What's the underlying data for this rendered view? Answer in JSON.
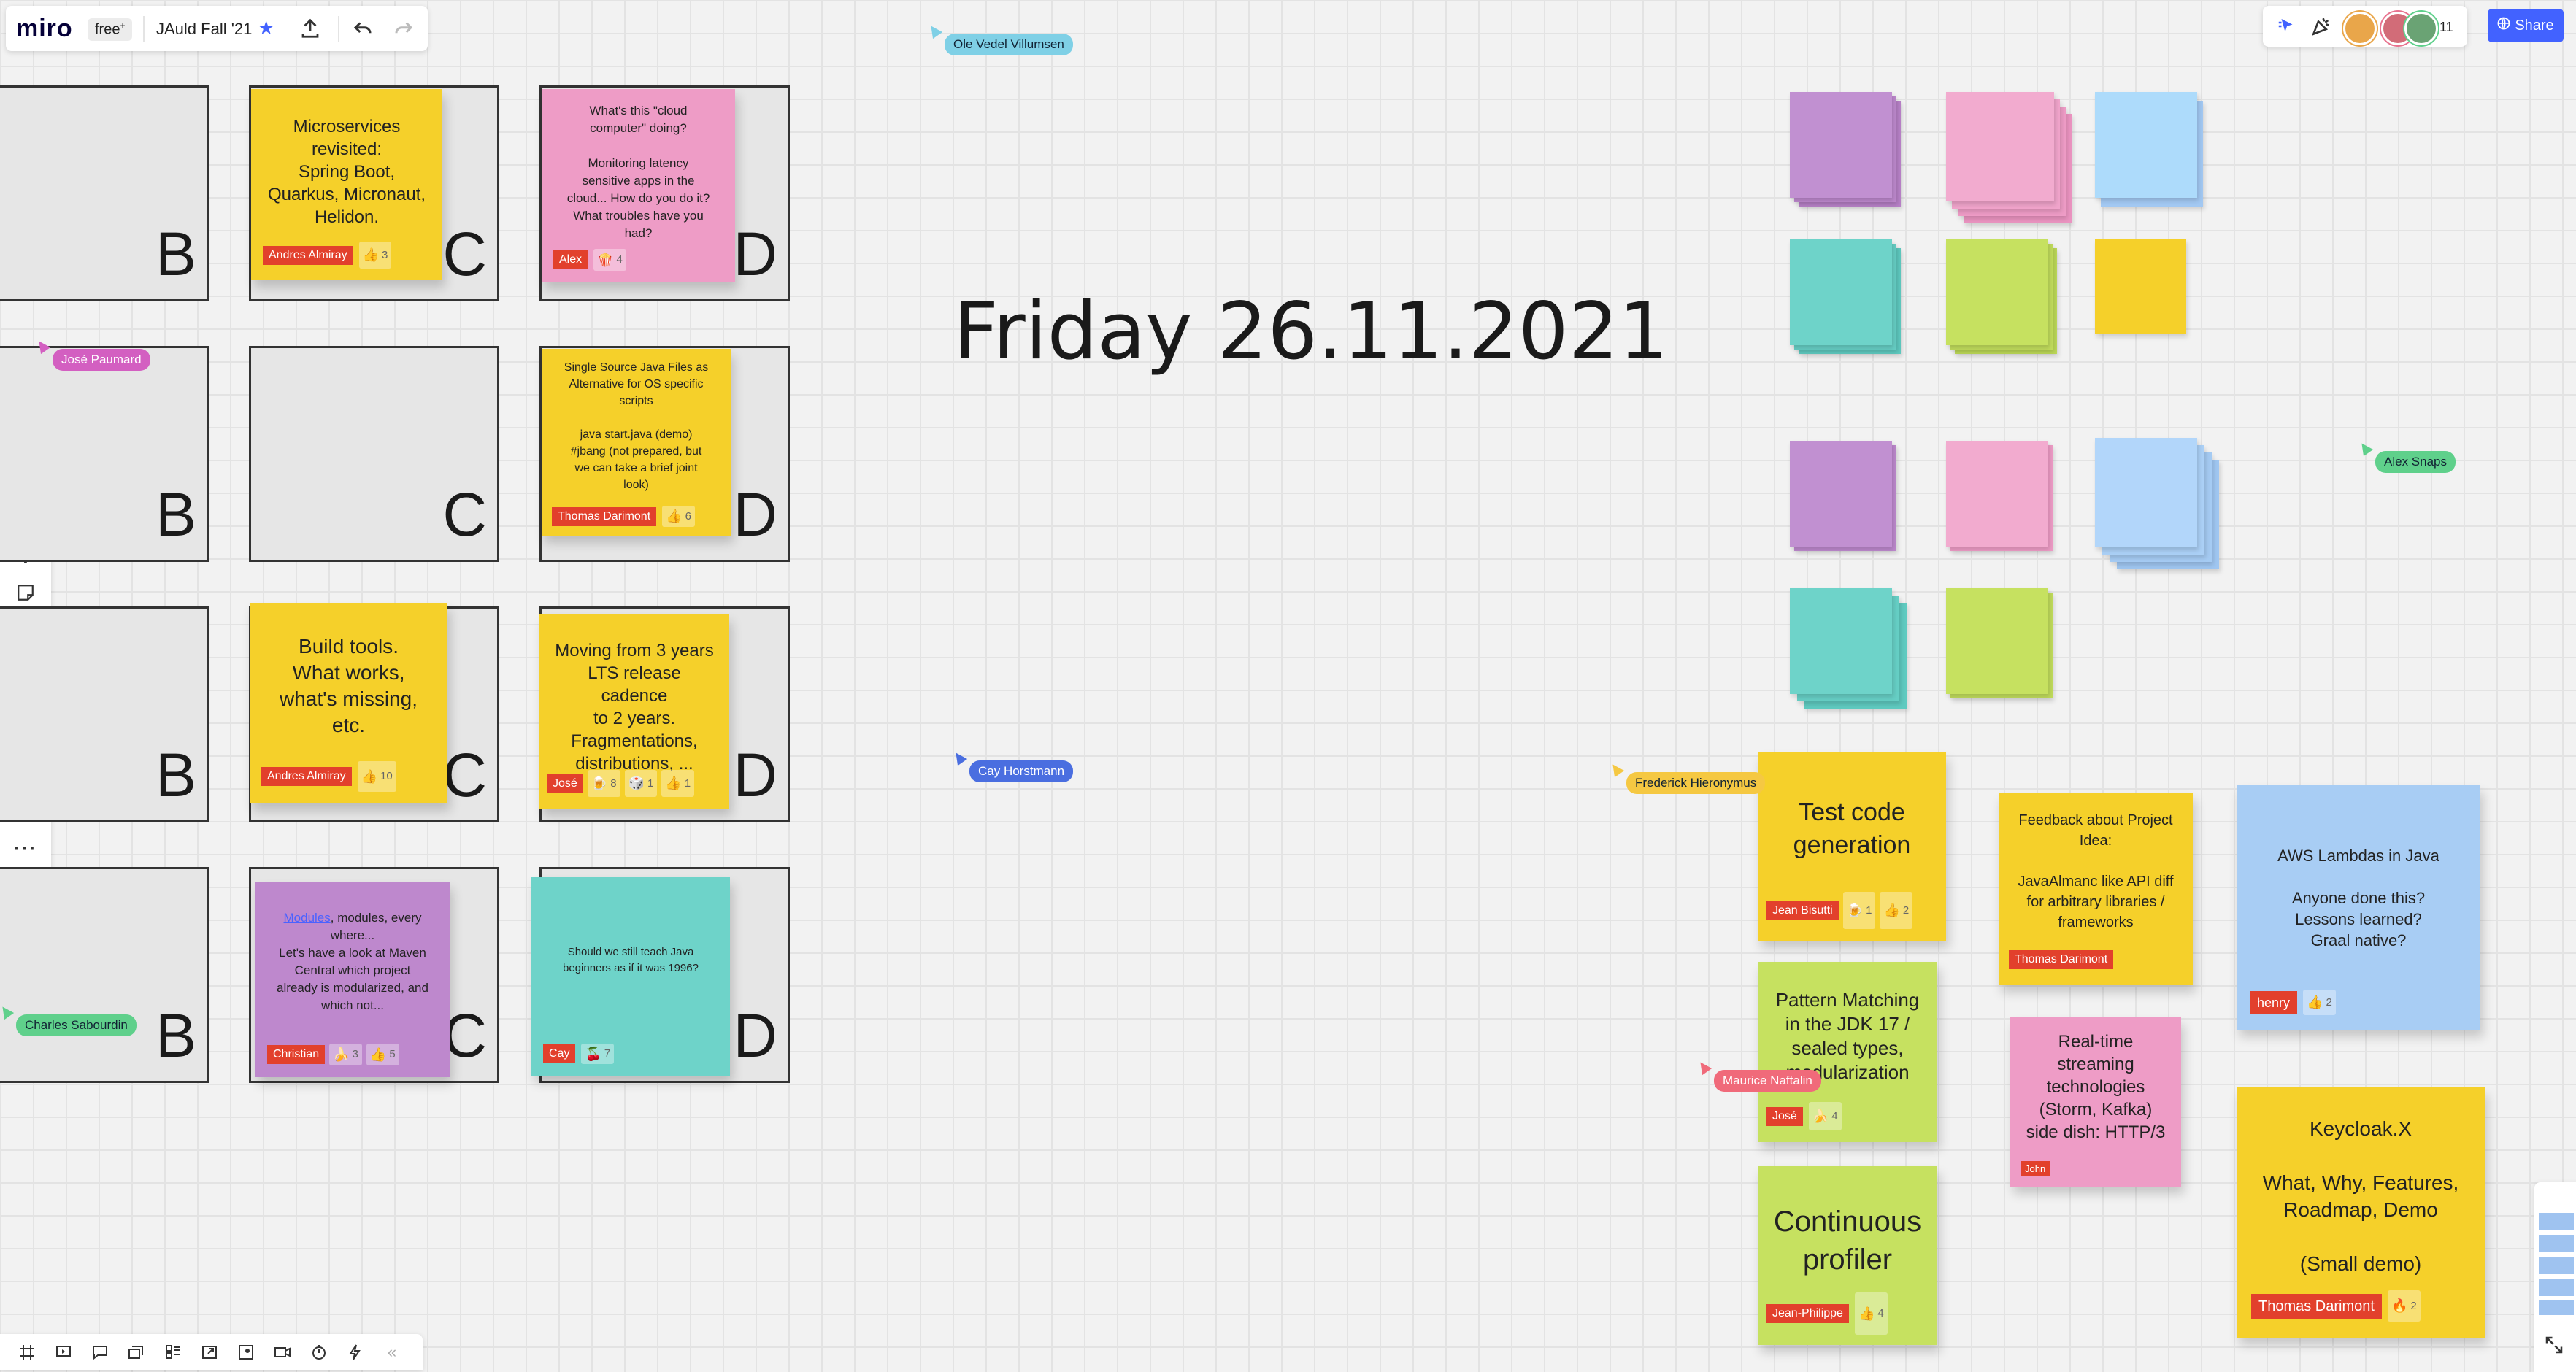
{
  "topbar": {
    "logo": "miro",
    "plan_badge": "free",
    "plan_badge_mark": "+",
    "board_name": "JAuld Fall '21",
    "star_icon": "star-icon",
    "export_icon": "upload-icon",
    "undo_icon": "undo-icon",
    "redo_icon": "redo-icon"
  },
  "collab": {
    "collaborator_count": "11",
    "share_label": "Share",
    "colors": {
      "share": "#4262ff"
    }
  },
  "board_title": "Friday 26.11.2021",
  "frame_letters": {
    "b": "B",
    "c": "C",
    "d": "D"
  },
  "notes": {
    "microservices": {
      "text": "Microservices\nrevisited:\nSpring Boot,\nQuarkus, Micronaut,\nHelidon.",
      "author": "Andres Almiray",
      "reaction_count": "3"
    },
    "cloud": {
      "text": "What's this \"cloud\ncomputer\" doing?\n\nMonitoring latency\nsensitive apps in the\ncloud... How do you do it?\nWhat troubles have you\nhad?",
      "author": "Alex",
      "reaction_count": "4"
    },
    "single_source": {
      "text": "Single Source Java Files as\nAlternative for OS specific\nscripts\n\njava start.java (demo)\n#jbang  (not prepared, but\nwe can take a brief joint\nlook)",
      "author": "Thomas Darimont",
      "reaction_count": "6"
    },
    "build_tools": {
      "text": "Build tools.\nWhat works,\nwhat's missing,\netc.",
      "author": "Andres Almiray",
      "reaction_count": "10"
    },
    "lts": {
      "text": "Moving from 3 years\nLTS release cadence\nto 2 years.\nFragmentations,\ndistributions, ...",
      "author": "José",
      "reaction_1": "8",
      "reaction_2": "1",
      "reaction_3": "1"
    },
    "modules": {
      "link_text": "Modules",
      "text": ", modules, every\nwhere...\nLet's have a look at Maven\nCentral which project\nalready is modularized, and\nwhich not...",
      "author": "Christian",
      "reaction_1": "3",
      "reaction_2": "5"
    },
    "teach_java": {
      "text": "Should we still teach Java\nbeginners as if it was 1996?",
      "author": "Cay",
      "reaction_count": "7"
    },
    "test_code": {
      "text": "Test code\ngeneration",
      "author": "Jean Bisutti",
      "reaction_1": "1",
      "reaction_2": "2"
    },
    "feedback": {
      "text": "Feedback about Project\nIdea:\n\nJavaAlmanc like API diff\nfor arbitrary libraries /\nframeworks",
      "author": "Thomas Darimont"
    },
    "aws": {
      "text": "AWS Lambdas in Java\n\nAnyone done this?\nLessons learned?\nGraal native?",
      "author": "henry",
      "reaction_count": "2"
    },
    "pattern": {
      "text": "Pattern Matching\nin the JDK 17 /\nsealed types,\nmodularization",
      "author": "José",
      "reaction_count": "4"
    },
    "realtime": {
      "text": "Real-time\nstreaming\ntechnologies\n(Storm, Kafka)\nside dish: HTTP/3",
      "author": "John"
    },
    "profiler": {
      "text": "Continuous\nprofiler",
      "author": "Jean-Philippe",
      "reaction_count": "4"
    },
    "keycloak": {
      "text": "Keycloak.X\n\nWhat, Why, Features,\nRoadmap, Demo\n\n(Small demo)",
      "author": "Thomas Darimont",
      "reaction_count": "2"
    }
  },
  "cursors": {
    "ole": "Ole Vedel Villumsen",
    "jose": "José Paumard",
    "charles": "Charles Sabourdin",
    "cay": "Cay Horstmann",
    "frederick": "Frederick Hieronymus",
    "maurice": "Maurice Naftalin",
    "alex": "Alex Snaps"
  },
  "cursor_colors": {
    "ole": "#7fd0e6",
    "jose": "#d35fc1",
    "charles": "#5fd08b",
    "cay": "#4a6ee0",
    "frederick": "#f5c842",
    "maurice": "#f06a7a",
    "alex": "#5fd08b"
  },
  "left_toolbar": {
    "icons": [
      "select-cursor-icon",
      "templates-icon",
      "text-icon",
      "sticky-note-icon",
      "shape-icon",
      "connection-line-icon",
      "pen-icon",
      "comment-icon",
      "frame-icon",
      "upload-icon",
      "more-icon",
      "apps-icon"
    ]
  },
  "bottom_toolbar": {
    "icons": [
      "frames-icon",
      "presentation-icon",
      "comments-icon",
      "cards-icon",
      "kanban-icon",
      "share-screen-icon",
      "embed-icon",
      "video-icon",
      "timer-icon",
      "voting-icon",
      "collapse-icon"
    ]
  }
}
